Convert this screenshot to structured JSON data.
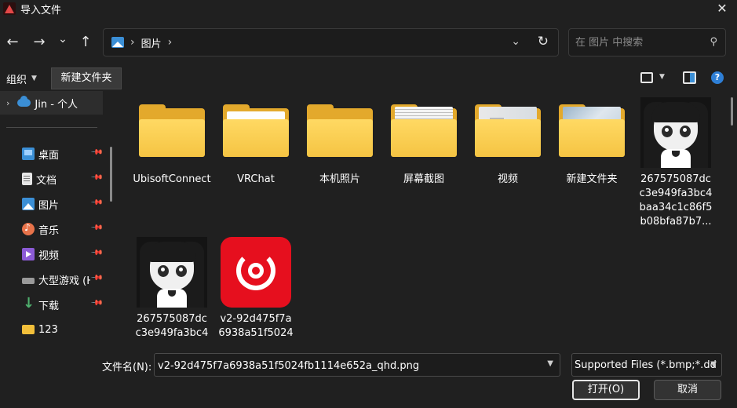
{
  "window": {
    "title": "导入文件",
    "close_label": "✕"
  },
  "nav": {
    "back": "←",
    "forward": "→",
    "recent": "⌄",
    "up": "↑",
    "breadcrumb": [
      "图片"
    ],
    "chevron": "⌄",
    "refresh": "↻",
    "search_placeholder": "在 图片 中搜索",
    "search_icon": "⚲"
  },
  "toolbar": {
    "organize_label": "组织",
    "new_folder_label": "新建文件夹",
    "help_label": "?"
  },
  "sidebar": {
    "top_item": {
      "label": "Jin - 个人",
      "icon": "cloud-icon"
    },
    "items": [
      {
        "label": "桌面",
        "icon": "desktop-icon",
        "pinned": true
      },
      {
        "label": "文档",
        "icon": "document-icon",
        "pinned": true
      },
      {
        "label": "图片",
        "icon": "pictures-icon",
        "pinned": true
      },
      {
        "label": "音乐",
        "icon": "music-icon",
        "pinned": true
      },
      {
        "label": "视频",
        "icon": "video-icon",
        "pinned": true
      },
      {
        "label": "大型游戏 (H",
        "icon": "drive-icon",
        "pinned": true
      },
      {
        "label": "下载",
        "icon": "download-icon",
        "pinned": true
      },
      {
        "label": "123",
        "icon": "folder-icon",
        "pinned": false
      }
    ]
  },
  "files": [
    {
      "name": "UbisoftConnect",
      "kind": "folder"
    },
    {
      "name": "VRChat",
      "kind": "folder"
    },
    {
      "name": "本机照片",
      "kind": "folder"
    },
    {
      "name": "屏幕截图",
      "kind": "folder"
    },
    {
      "name": "视频",
      "kind": "folder"
    },
    {
      "name": "新建文件夹",
      "kind": "folder"
    },
    {
      "name": "267575087dc c3e949fa3bc4 baa34c1c86f5 b08bfa87b7...",
      "kind": "image"
    },
    {
      "name": "267575087dc c3e949fa3bc4",
      "kind": "image"
    },
    {
      "name": "v2-92d475f7a 6938a51f5024",
      "kind": "image"
    }
  ],
  "footer": {
    "filename_label": "文件名(N):",
    "filename_value": "v2-92d475f7a6938a51f5024fb1114e652a_qhd.png",
    "filetype_value": "Supported Files (*.bmp;*.dd",
    "open_label": "打开(O)",
    "cancel_label": "取消"
  },
  "colors": {
    "background": "#202020",
    "accent": "#2e7fd6",
    "folder": "#f5c443"
  }
}
